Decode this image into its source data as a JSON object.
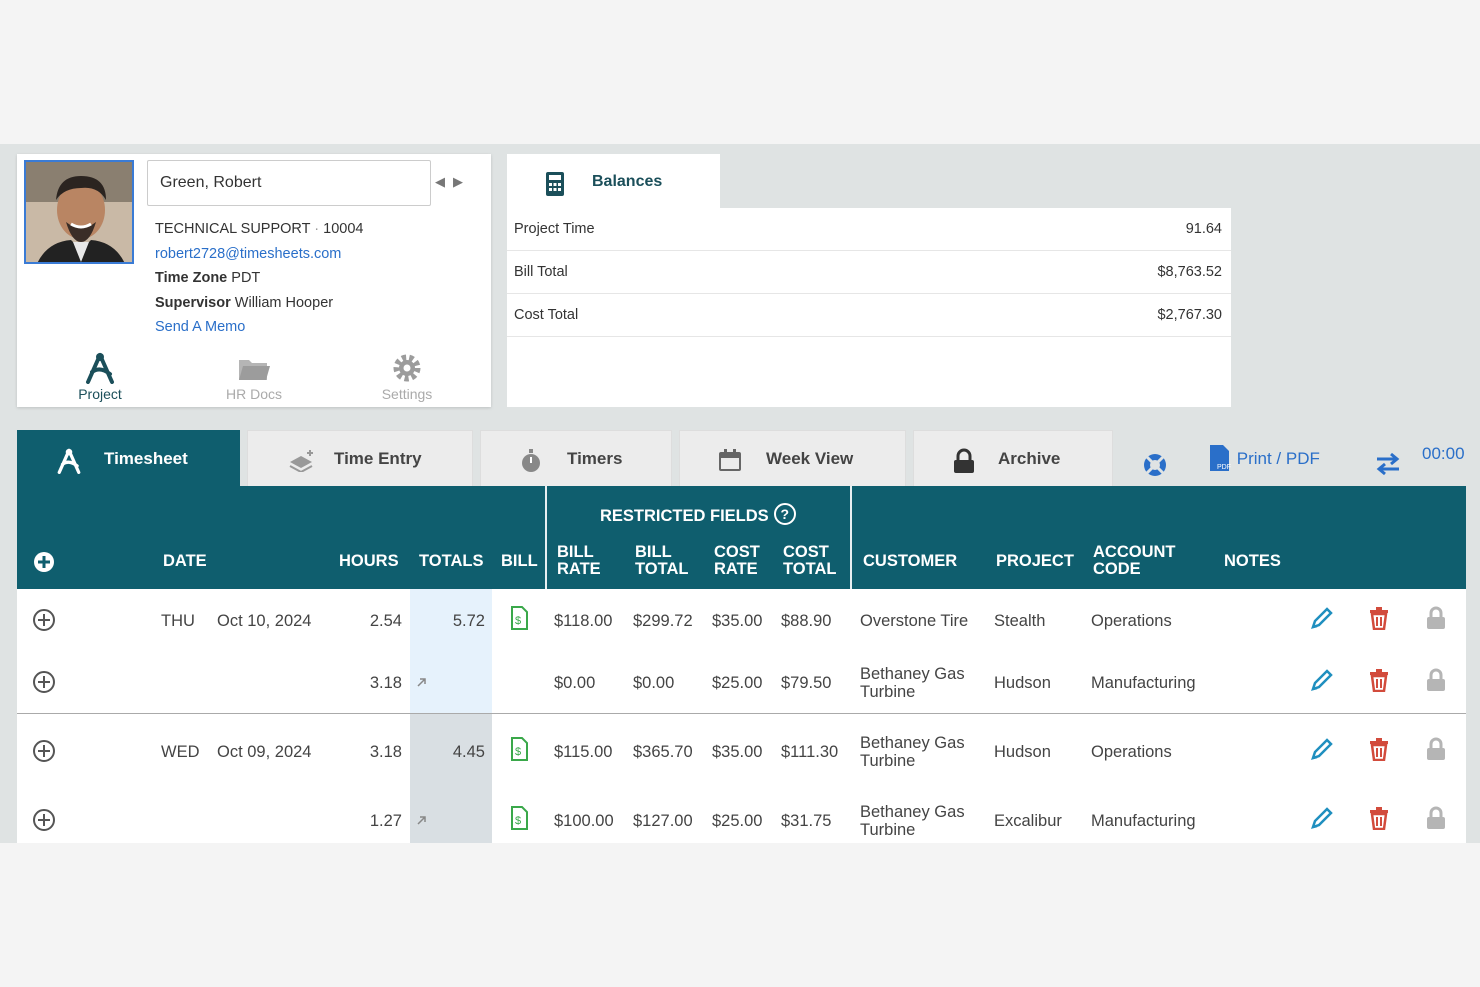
{
  "employee": {
    "name": "Green, Robert",
    "department": "TECHNICAL SUPPORT",
    "separator": "·",
    "employee_id": "10004",
    "email": "robert2728@timesheets.com",
    "time_zone_label": "Time Zone",
    "time_zone": "PDT",
    "supervisor_label": "Supervisor",
    "supervisor": "William Hooper",
    "memo_link": "Send A Memo",
    "nav": [
      "Project",
      "HR Docs",
      "Settings"
    ]
  },
  "balances": {
    "tab_label": "Balances",
    "rows": [
      {
        "label": "Project Time",
        "value": "91.64"
      },
      {
        "label": "Bill Total",
        "value": "$8,763.52"
      },
      {
        "label": "Cost Total",
        "value": "$2,767.30"
      }
    ]
  },
  "tabs": [
    "Timesheet",
    "Time Entry",
    "Timers",
    "Week View",
    "Archive"
  ],
  "tools": {
    "print_label": "Print / PDF",
    "timer": "00:00"
  },
  "table": {
    "restricted_label": "RESTRICTED FIELDS",
    "headers": {
      "date": "DATE",
      "hours": "HOURS",
      "totals": "TOTALS",
      "bill": "BILL",
      "bill_rate_1": "BILL",
      "bill_rate_2": "RATE",
      "bill_total_1": "BILL",
      "bill_total_2": "TOTAL",
      "cost_rate_1": "COST",
      "cost_rate_2": "RATE",
      "cost_total_1": "COST",
      "cost_total_2": "TOTAL",
      "customer": "CUSTOMER",
      "project": "PROJECT",
      "account_1": "ACCOUNT",
      "account_2": "CODE",
      "notes": "NOTES"
    },
    "rows": [
      {
        "day": "THU",
        "date": "Oct 10, 2024",
        "hours": "2.54",
        "total": "5.72",
        "bill_rate": "$118.00",
        "bill_total": "$299.72",
        "cost_rate": "$35.00",
        "cost_total": "$88.90",
        "customer_1": "Overstone Tire",
        "customer_2": "",
        "project": "Stealth",
        "account": "Operations"
      },
      {
        "day": "",
        "date": "",
        "hours": "3.18",
        "total": "",
        "bill_rate": "$0.00",
        "bill_total": "$0.00",
        "cost_rate": "$25.00",
        "cost_total": "$79.50",
        "customer_1": "Bethaney Gas",
        "customer_2": "Turbine",
        "project": "Hudson",
        "account": "Manufacturing"
      },
      {
        "day": "WED",
        "date": "Oct 09, 2024",
        "hours": "3.18",
        "total": "4.45",
        "bill_rate": "$115.00",
        "bill_total": "$365.70",
        "cost_rate": "$35.00",
        "cost_total": "$111.30",
        "customer_1": "Bethaney Gas",
        "customer_2": "Turbine",
        "project": "Hudson",
        "account": "Operations"
      },
      {
        "day": "",
        "date": "",
        "hours": "1.27",
        "total": "",
        "bill_rate": "$100.00",
        "bill_total": "$127.00",
        "cost_rate": "$25.00",
        "cost_total": "$31.75",
        "customer_1": "Bethaney Gas",
        "customer_2": "Turbine",
        "project": "Excalibur",
        "account": "Manufacturing"
      }
    ]
  },
  "colors": {
    "primary": "#0f5e6e",
    "link": "#2a6fc9",
    "delete": "#d24b3c",
    "edit": "#1f8fbf"
  }
}
